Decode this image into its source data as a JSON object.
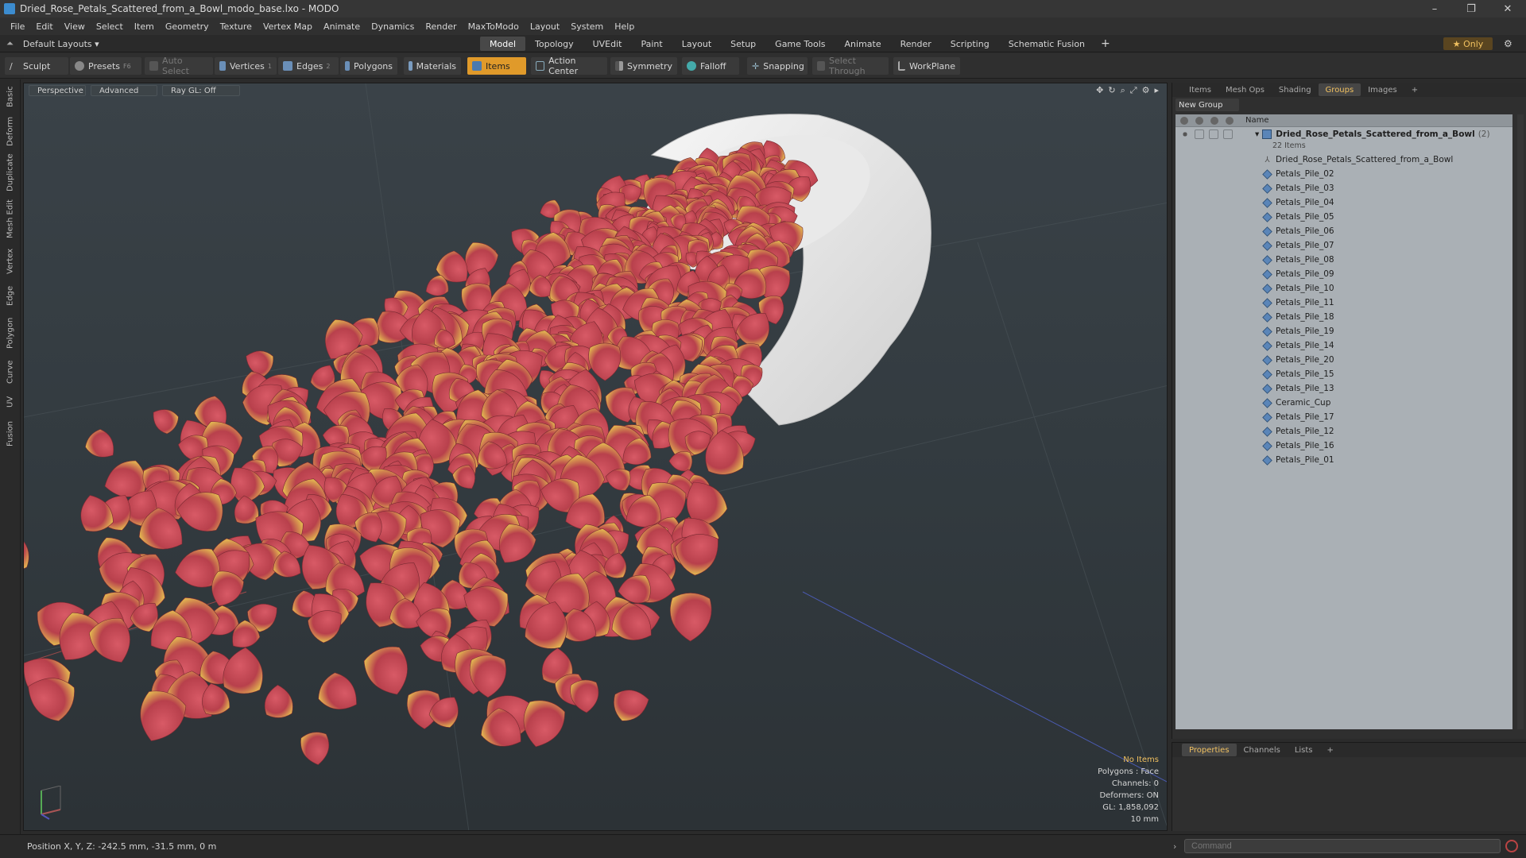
{
  "window": {
    "title": "Dried_Rose_Petals_Scattered_from_a_Bowl_modo_base.lxo - MODO",
    "min": "–",
    "max": "❐",
    "close": "✕"
  },
  "menu": [
    "File",
    "Edit",
    "View",
    "Select",
    "Item",
    "Geometry",
    "Texture",
    "Vertex Map",
    "Animate",
    "Dynamics",
    "Render",
    "MaxToModo",
    "Layout",
    "System",
    "Help"
  ],
  "layout": {
    "label": "Default Layouts ▾",
    "tabs": [
      "Model",
      "Topology",
      "UVEdit",
      "Paint",
      "Layout",
      "Setup",
      "Game Tools",
      "Animate",
      "Render",
      "Scripting",
      "Schematic Fusion"
    ],
    "active_tab": "Model",
    "plus": "+",
    "only_label": "★ Only"
  },
  "toolbar": {
    "sculpt": "Sculpt",
    "presets": "Presets",
    "presets_key": "F6",
    "auto_select": "Auto Select",
    "vertices": "Vertices",
    "vertices_key": "1",
    "edges": "Edges",
    "edges_key": "2",
    "polygons": "Polygons",
    "materials": "Materials",
    "items": "Items",
    "action_center": "Action Center",
    "symmetry": "Symmetry",
    "falloff": "Falloff",
    "snapping": "Snapping",
    "select_through": "Select Through",
    "workplane": "WorkPlane"
  },
  "left_tabs": [
    "Basic",
    "Deform",
    "Duplicate",
    "Mesh Edit",
    "Vertex",
    "Edge",
    "Polygon",
    "Curve",
    "UV",
    "Fusion"
  ],
  "viewport": {
    "perspective": "Perspective",
    "advanced": "Advanced",
    "raygl": "Ray GL: Off",
    "info": {
      "selection": "No Items",
      "polygons": "Polygons : Face",
      "channels": "Channels: 0",
      "deformers": "Deformers: ON",
      "gl": "GL: 1,858,092",
      "scale": "10 mm"
    }
  },
  "right_panel": {
    "tabs": [
      "Items",
      "Mesh Ops",
      "Shading",
      "Groups",
      "Images"
    ],
    "active_tab": "Groups",
    "plus": "+",
    "new_group": "New Group",
    "name_header": "Name",
    "group_name": "Dried_Rose_Petals_Scattered_from_a_Bowl",
    "group_count": "(2)",
    "group_items": "22 Items",
    "items": [
      "Dried_Rose_Petals_Scattered_from_a_Bowl",
      "Petals_Pile_02",
      "Petals_Pile_03",
      "Petals_Pile_04",
      "Petals_Pile_05",
      "Petals_Pile_06",
      "Petals_Pile_07",
      "Petals_Pile_08",
      "Petals_Pile_09",
      "Petals_Pile_10",
      "Petals_Pile_11",
      "Petals_Pile_18",
      "Petals_Pile_19",
      "Petals_Pile_14",
      "Petals_Pile_20",
      "Petals_Pile_15",
      "Petals_Pile_13",
      "Ceramic_Cup",
      "Petals_Pile_17",
      "Petals_Pile_12",
      "Petals_Pile_16",
      "Petals_Pile_01"
    ]
  },
  "props_panel": {
    "tabs": [
      "Properties",
      "Channels",
      "Lists"
    ],
    "active_tab": "Properties",
    "plus": "+"
  },
  "status": {
    "position": "Position X, Y, Z:  -242.5 mm, -31.5 mm, 0 m",
    "command_placeholder": "Command"
  },
  "colors": {
    "accent": "#e09a2a",
    "petal": "#c84a55",
    "petal_tip": "#e0b050",
    "bowl": "#efefef"
  }
}
